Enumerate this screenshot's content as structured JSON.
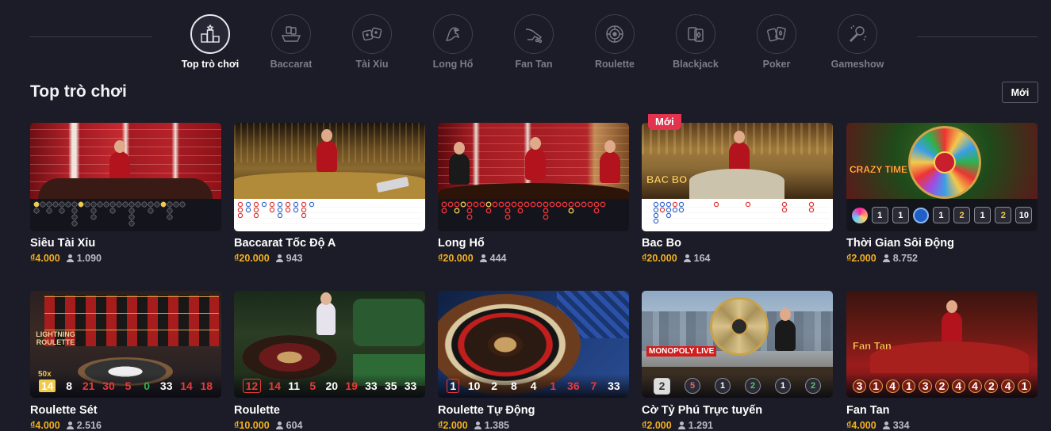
{
  "categories": [
    {
      "label": "Top trò chơi",
      "icon": "podium-icon",
      "active": true
    },
    {
      "label": "Baccarat",
      "icon": "baccarat-table-icon",
      "active": false
    },
    {
      "label": "Tài Xỉu",
      "icon": "dice-icon",
      "active": false
    },
    {
      "label": "Long Hổ",
      "icon": "dragon-tiger-icon",
      "active": false
    },
    {
      "label": "Fan Tan",
      "icon": "fan-tan-hand-icon",
      "active": false
    },
    {
      "label": "Roulette",
      "icon": "roulette-wheel-icon",
      "active": false
    },
    {
      "label": "Blackjack",
      "icon": "blackjack-cards-icon",
      "active": false
    },
    {
      "label": "Poker",
      "icon": "poker-cards-icon",
      "active": false
    },
    {
      "label": "Gameshow",
      "icon": "microphone-icon",
      "active": false
    }
  ],
  "section": {
    "title": "Top trò chơi",
    "new_button": "Mới"
  },
  "colors": {
    "background": "#1b1c27",
    "price": "#f2b01e",
    "badge": "#e2334f",
    "red_number": "#e83a3a",
    "green_number": "#2fb14a"
  },
  "games_row1": [
    {
      "name": "Siêu Tài Xỉu",
      "price": "₫4.000",
      "players": "1.090"
    },
    {
      "name": "Baccarat Tốc Độ A",
      "price": "₫20.000",
      "players": "943"
    },
    {
      "name": "Long Hổ",
      "price": "₫20.000",
      "players": "444"
    },
    {
      "name": "Bac Bo",
      "price": "₫20.000",
      "players": "164",
      "badge": "Mới"
    },
    {
      "name": "Thời Gian Sôi Động",
      "price": "₫2.000",
      "players": "8.752",
      "results": [
        "1",
        "1",
        "1",
        "2",
        "1",
        "2",
        "10"
      ]
    }
  ],
  "games_row2": [
    {
      "name": "Roulette Sét",
      "price": "₫4.000",
      "players": "2.516",
      "multiplier": "50x",
      "results": [
        "14",
        "8",
        "21",
        "30",
        "5",
        "0",
        "33",
        "14",
        "18"
      ]
    },
    {
      "name": "Roulette",
      "price": "₫10.000",
      "players": "604",
      "results": [
        "12",
        "14",
        "11",
        "5",
        "20",
        "19",
        "33",
        "35",
        "33"
      ]
    },
    {
      "name": "Roulette Tự Động",
      "price": "₫2.000",
      "players": "1.385",
      "results": [
        "1",
        "10",
        "2",
        "8",
        "4",
        "1",
        "36",
        "7",
        "33"
      ]
    },
    {
      "name": "Cờ Tỷ Phú Trực tuyến",
      "price": "₫2.000",
      "players": "1.291",
      "results": [
        "2",
        "5",
        "1",
        "2",
        "1",
        "2"
      ]
    },
    {
      "name": "Fan Tan",
      "price": "₫4.000",
      "players": "334",
      "results": [
        "3",
        "1",
        "4",
        "1",
        "3",
        "2",
        "4",
        "4",
        "2",
        "4",
        "1"
      ]
    }
  ],
  "scene_text": {
    "bac_bo_logo": "BAC BO",
    "crazy_time_logo": "CRAZY TIME",
    "lightning_logo": "LIGHTNING ROULETTE",
    "monopoly_logo": "MONOPOLY LIVE",
    "fantan_logo": "Fan Tan"
  }
}
